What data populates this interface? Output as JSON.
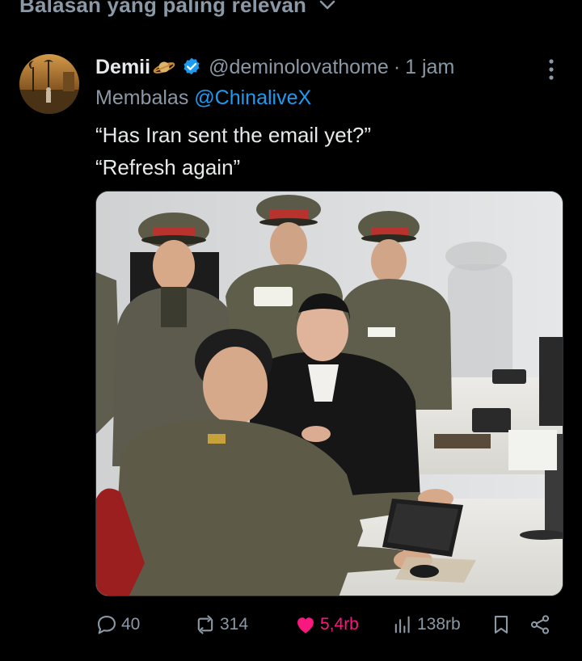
{
  "header": {
    "label": "Balasan yang paling relevan"
  },
  "tweet": {
    "author_name": "Demii",
    "author_emoji_icon": "ringed-planet-emoji-icon",
    "verified_icon": "verified-badge-icon",
    "handle": "@deminolovathome",
    "separator": "·",
    "time": "1 jam",
    "reply_prefix": "Membalas",
    "reply_to": "@ChinaliveX",
    "text_lines": [
      "“Has Iran sent the email yet?”",
      "“Refresh again”"
    ],
    "media_description_icon": "photo-officers-watching-computer-icon",
    "actions": {
      "replies": "40",
      "reposts": "314",
      "likes": "5,4rb",
      "views": "138rb"
    }
  },
  "colors": {
    "background": "#000000",
    "primary_text": "#e7e9ea",
    "secondary_text": "#8b98a5",
    "link": "#1d9bf0",
    "like": "#f91880"
  }
}
